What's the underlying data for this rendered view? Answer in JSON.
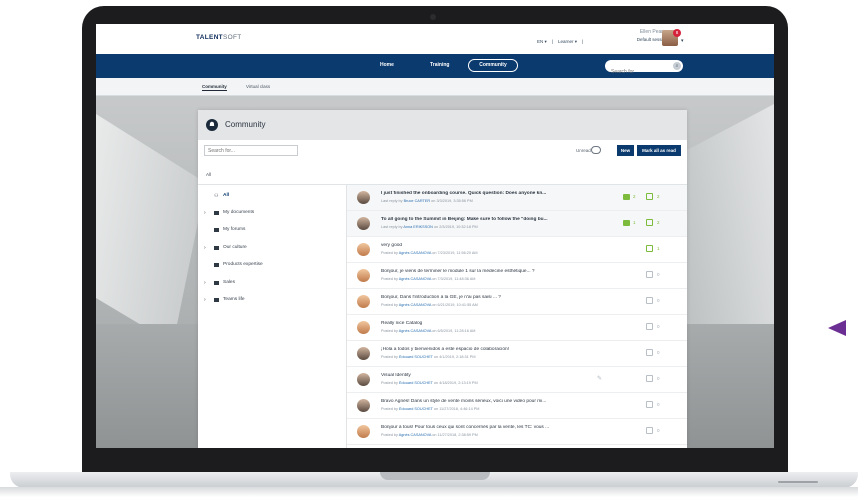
{
  "app": {
    "logo_main": "TALENT",
    "logo_suffix": "SOFT"
  },
  "topbar": {
    "language": "EN ▾",
    "role": "Learner ▾",
    "user_name": "Ellen Pearson",
    "session": "Default session ▾",
    "notification_count": "8",
    "caret": "▾"
  },
  "nav": {
    "home": "Home",
    "training": "Training",
    "community": "Community",
    "search_placeholder": "Search for",
    "search_icon": "search-icon"
  },
  "subtabs": {
    "community": "Community",
    "virtual_class": "Virtual class"
  },
  "panel": {
    "title": "Community",
    "search_placeholder": "Search for...",
    "unread_label": "Unread",
    "new_button": "New",
    "mark_all_button": "Mark all as read",
    "filter_label": "All"
  },
  "tree": [
    {
      "label": "All",
      "expandable": false,
      "icon": "people-icon"
    },
    {
      "label": "My documents",
      "expandable": true,
      "icon": "folder-icon"
    },
    {
      "label": "My forums",
      "expandable": false,
      "icon": "folder-icon"
    },
    {
      "label": "Our culture",
      "expandable": true,
      "icon": "folder-icon"
    },
    {
      "label": "Products expertise",
      "expandable": false,
      "icon": "folder-icon"
    },
    {
      "label": "Sales",
      "expandable": true,
      "icon": "folder-icon"
    },
    {
      "label": "Teams life",
      "expandable": true,
      "icon": "folder-icon"
    }
  ],
  "posts": [
    {
      "title": "I just finished the onboarding course. Quick question: Does anyone kn...",
      "meta_prefix": "Last reply by",
      "author": "Bruce CARTER",
      "meta_suffix": "on 3/3/2019, 3:35:56 PM",
      "bold": true,
      "comments": "2",
      "likes": "2",
      "avatar": "m"
    },
    {
      "title": "To all going to the Summit in Beijing: Make sure to follow the \"doing bu...",
      "meta_prefix": "Last reply by",
      "author": "Anna ERIKSSON",
      "meta_suffix": "on 2/3/2019, 10:32:18 PM",
      "bold": true,
      "comments": "1",
      "likes": "2",
      "avatar": "m"
    },
    {
      "title": "very good",
      "meta_prefix": "Posted by",
      "author": "Agnès CASANOVA",
      "meta_suffix": "on 7/23/2019, 11:56:20 AM",
      "bold": false,
      "comments": "",
      "likes": "1",
      "avatar": "w"
    },
    {
      "title": "Bonjour, je viens de terminer le module 1 sur la médecine esthétique... ?",
      "meta_prefix": "Posted by",
      "author": "Agnès CASANOVA",
      "meta_suffix": "on 7/3/2019, 11:48:36 AM",
      "bold": false,
      "comments": "",
      "likes": "0",
      "avatar": "w"
    },
    {
      "title": "Bonjour, Dans l'introduction à la GE, je n'ai pas saisi ... ?",
      "meta_prefix": "Posted by",
      "author": "Agnès CASANOVA",
      "meta_suffix": "on 6/21/2019, 10:41:55 AM",
      "bold": false,
      "comments": "",
      "likes": "0",
      "avatar": "w"
    },
    {
      "title": "Really nice Catalog",
      "meta_prefix": "Posted by",
      "author": "Agnès CASANOVA",
      "meta_suffix": "on 6/5/2019, 11:28:16 AM",
      "bold": false,
      "comments": "",
      "likes": "0",
      "avatar": "w"
    },
    {
      "title": "¡Hola a todos y bienvenidos a este espacio de colaboración!",
      "meta_prefix": "Posted by",
      "author": "Édouard SOUCHET",
      "meta_suffix": "on 4/1/2019, 2:18:31 PM",
      "bold": false,
      "comments": "",
      "likes": "0",
      "avatar": "m"
    },
    {
      "title": "Visual Identity",
      "meta_prefix": "Posted by",
      "author": "Édouard SOUCHET",
      "meta_suffix": "on 4/18/2019, 2:13:19 PM",
      "bold": false,
      "comments": "",
      "likes": "0",
      "avatar": "m",
      "editable": true
    },
    {
      "title": "Bravo Agnès! Dans un style de vente moins sérieux, voici une vidéo pour mi...",
      "meta_prefix": "Posted by",
      "author": "Édouard SOUCHET",
      "meta_suffix": "on 11/27/2018, 4:46:14 PM",
      "bold": false,
      "comments": "",
      "likes": "0",
      "avatar": "m"
    },
    {
      "title": "Bonjour à tous! Pour tous ceux qui sont concernés par la vente, les TC: vous ...",
      "meta_prefix": "Posted by",
      "author": "Agnès CASANOVA",
      "meta_suffix": "on 11/27/2018, 2:38:59 PM",
      "bold": false,
      "comments": "",
      "likes": "0",
      "avatar": "w"
    }
  ],
  "colors": {
    "brand_navy": "#0b3a6e",
    "accent_green": "#7dbb3c",
    "badge_red": "#d6213a",
    "pointer_purple": "#6b2f93"
  }
}
